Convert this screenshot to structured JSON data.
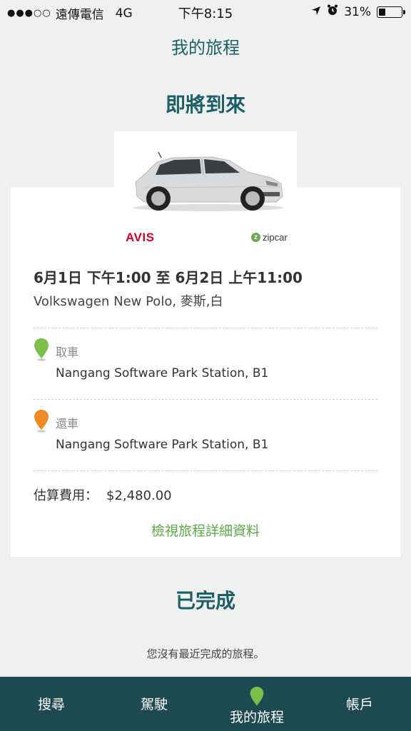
{
  "status_bar": {
    "carrier": "遠傳電信",
    "network": "4G",
    "time": "下午8:15",
    "battery": "31%",
    "battery_level": 0.31
  },
  "header": {
    "title": "我的旅程"
  },
  "upcoming": {
    "section_title": "即將到來",
    "brands": {
      "avis": "AVIS",
      "zipcar": "zipcar"
    },
    "trip_time": "6月1日 下午1:00 至 6月2日 上午11:00",
    "car_description": "Volkswagen New Polo, 麥斯,白",
    "pickup": {
      "label": "取車",
      "location": "Nangang Software Park Station, B1",
      "pin_color": "#7cc04b"
    },
    "return": {
      "label": "還車",
      "location": "Nangang Software Park Station, B1",
      "pin_color": "#f08a24"
    },
    "cost_label": "估算費用：",
    "cost_value": "$2,480.00",
    "details_link": "檢視旅程詳細資料"
  },
  "completed": {
    "section_title": "已完成",
    "empty_message": "您沒有最近完成的旅程。"
  },
  "tab_bar": {
    "tabs": [
      {
        "label": "搜尋"
      },
      {
        "label": "駕駛"
      },
      {
        "label": "我的旅程",
        "active": true,
        "icon": "map-pin-icon"
      },
      {
        "label": "帳戶"
      }
    ]
  },
  "colors": {
    "primary": "#1d5f66",
    "tabbar": "#1d4a50",
    "link": "#5aaa45",
    "avis": "#d4002a"
  }
}
